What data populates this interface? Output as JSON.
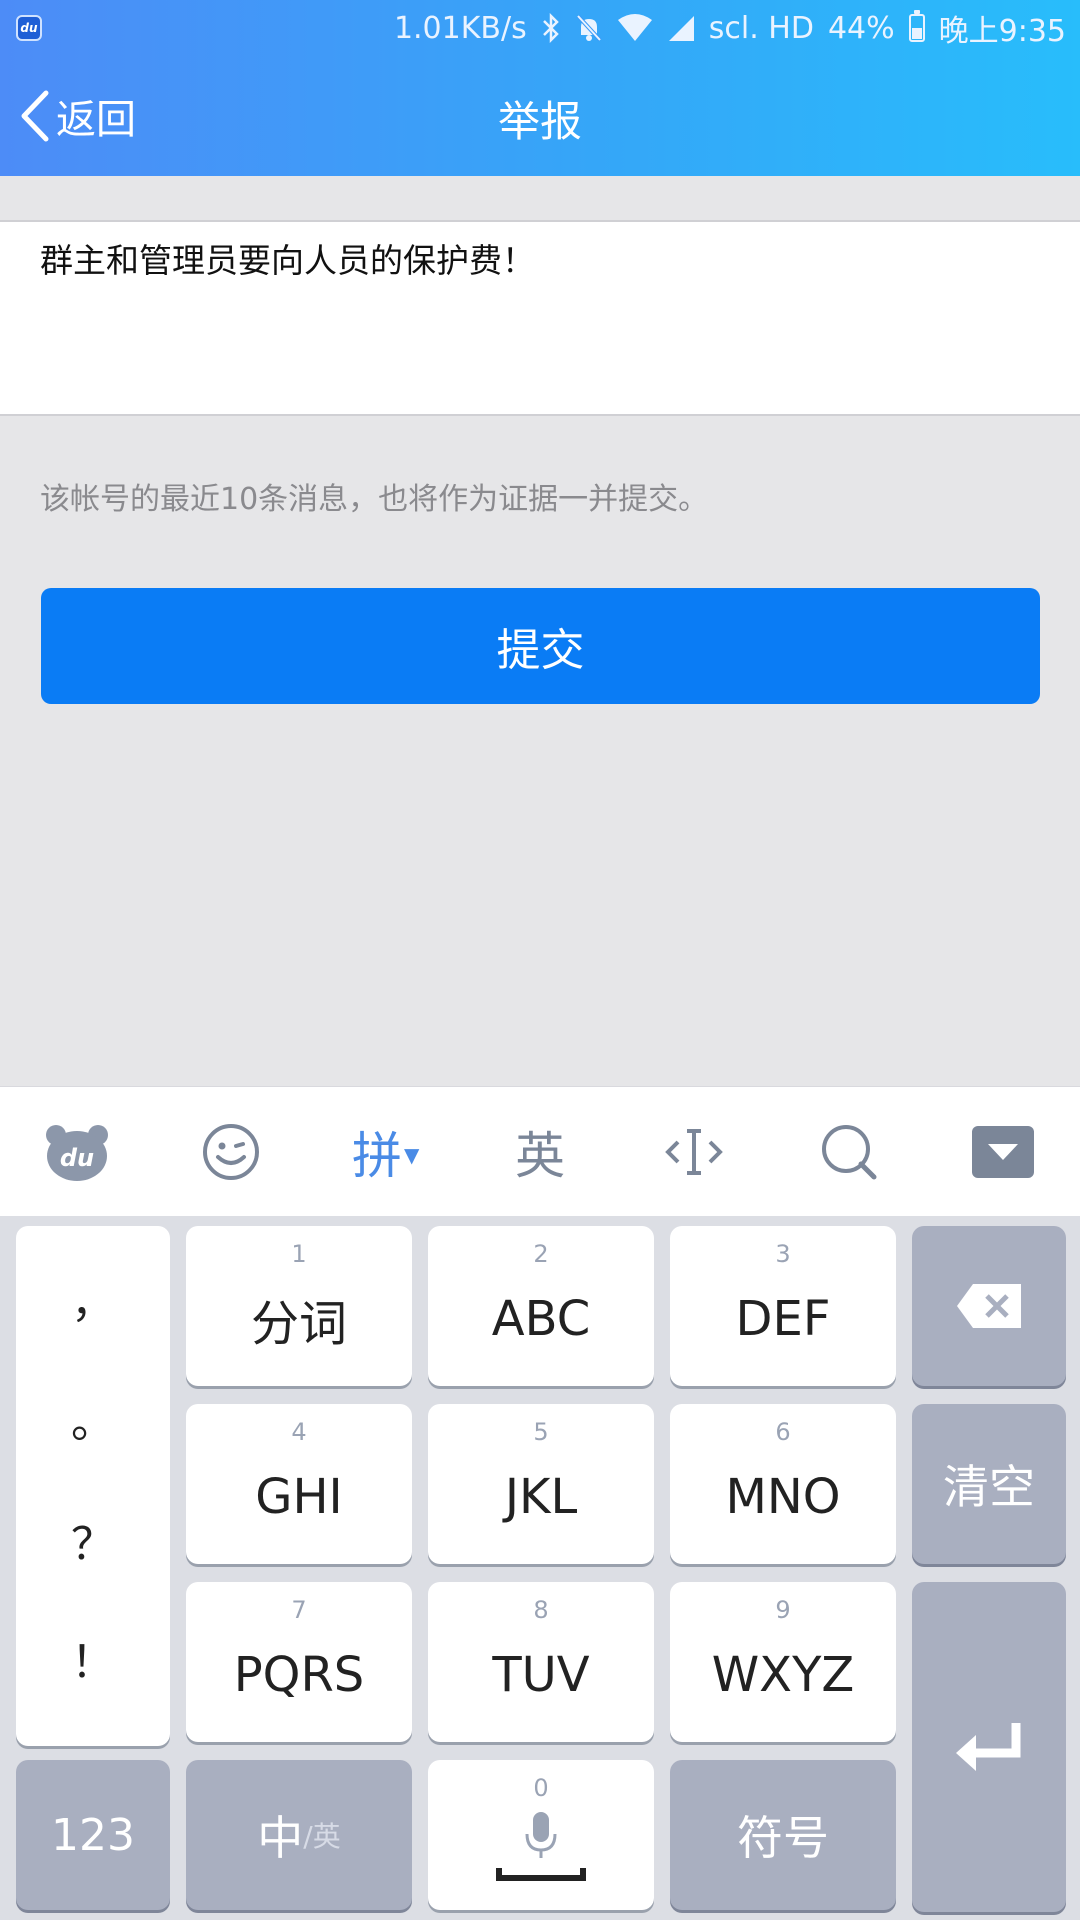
{
  "status_bar": {
    "app_badge": "du",
    "network_speed": "1.01KB/s",
    "carrier": "scl. HD",
    "battery_percent": "44%",
    "battery_level": 0.44,
    "time": "晚上9:35"
  },
  "nav": {
    "back_label": "返回",
    "title": "举报"
  },
  "report": {
    "text": "群主和管理员要向人员的保护费！"
  },
  "hint": "该帐号的最近10条消息，也将作为证据一并提交。",
  "submit_label": "提交",
  "ime_toolbar": {
    "pinyin_label": "拼",
    "english_label": "英"
  },
  "keyboard": {
    "punctuation": [
      "，",
      "。",
      "？",
      "！"
    ],
    "keys": [
      {
        "num": "1",
        "label": "分词"
      },
      {
        "num": "2",
        "label": "ABC"
      },
      {
        "num": "3",
        "label": "DEF"
      },
      {
        "num": "4",
        "label": "GHI"
      },
      {
        "num": "5",
        "label": "JKL"
      },
      {
        "num": "6",
        "label": "MNO"
      },
      {
        "num": "7",
        "label": "PQRS"
      },
      {
        "num": "8",
        "label": "TUV"
      },
      {
        "num": "9",
        "label": "WXYZ"
      }
    ],
    "clear_label": "清空",
    "num_mode_label": "123",
    "lang_main": "中",
    "lang_alt": "/英",
    "space_num": "0",
    "symbols_label": "符号"
  },
  "colors": {
    "header_start": "#4d8cf7",
    "header_end": "#28bdfb",
    "submit": "#0a7cf5",
    "accent": "#4a8be6"
  }
}
